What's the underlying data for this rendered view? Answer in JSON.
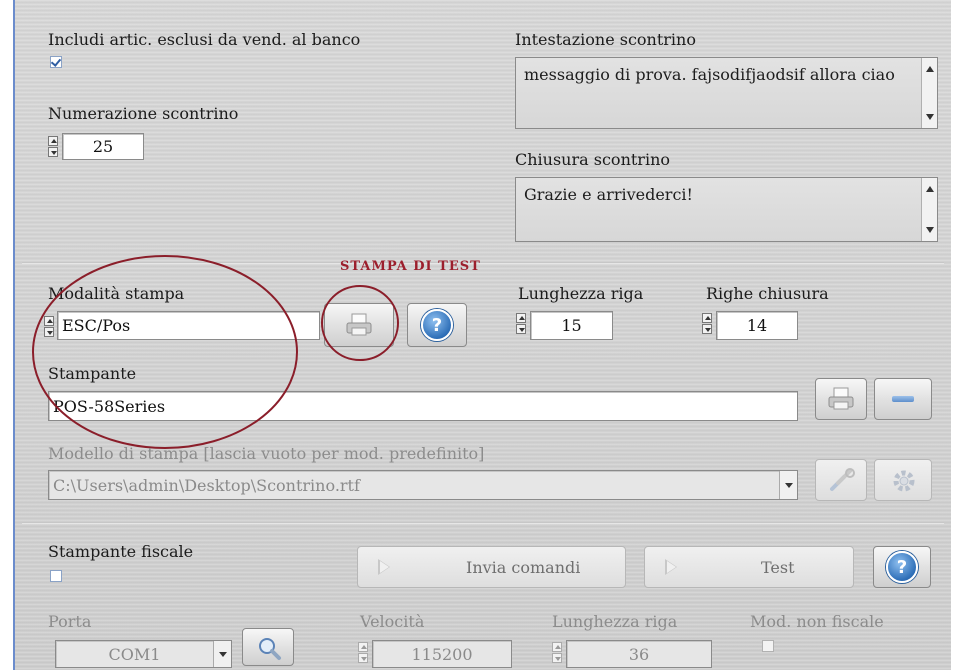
{
  "receipt": {
    "include_label": "Includi artic. esclusi da vend. al banco",
    "include_checked": true,
    "numbering_label": "Numerazione scontrino",
    "numbering_value": "25",
    "header_label": "Intestazione scontrino",
    "header_text": "messaggio di prova. fajsodifjaodsif allora ciao",
    "closing_label": "Chiusura scontrino",
    "closing_text": "Grazie e arrivederci!"
  },
  "annotation": {
    "title": "STAMPA DI TEST",
    "color": "#9c1f2d"
  },
  "print": {
    "mode_label": "Modalità stampa",
    "mode_value": "ESC/Pos",
    "line_length_label": "Lunghezza riga",
    "line_length_value": "15",
    "closing_lines_label": "Righe chiusura",
    "closing_lines_value": "14",
    "printer_label": "Stampante",
    "printer_value": "POS-58Series",
    "template_label": "Modello di stampa [lascia vuoto per mod. predefinito]",
    "template_value": "C:\\Users\\admin\\Desktop\\Scontrino.rtf"
  },
  "fiscal": {
    "label": "Stampante fiscale",
    "checked": false,
    "send_commands_label": "Invia comandi",
    "test_label": "Test",
    "port_label": "Porta",
    "port_value": "COM1",
    "speed_label": "Velocità",
    "speed_value": "115200",
    "line_length_label": "Lunghezza riga",
    "line_length_value": "36",
    "non_fiscal_label": "Mod. non fiscale"
  },
  "icons": {
    "printer": "printer-icon",
    "help": "help-icon",
    "minus": "minus-icon",
    "tools": "tools-icon",
    "gear": "gear-icon",
    "search": "search-icon"
  }
}
